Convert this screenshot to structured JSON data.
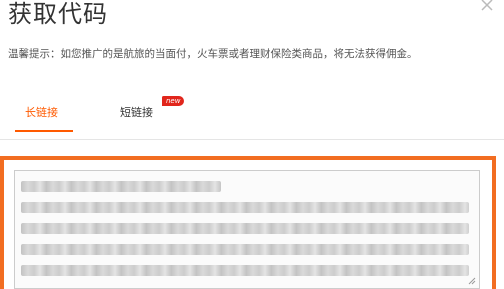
{
  "dialog": {
    "title": "获取代码",
    "tip": "温馨提示：如您推广的是航旅的当面付，火车票或者理财保险类商品，将无法获得佣金。"
  },
  "tabs": {
    "long_label": "长链接",
    "short_label": "短链接",
    "short_badge": "new"
  },
  "colors": {
    "accent": "#ff5a00",
    "frame": "#f26d21",
    "badge": "#e1261c"
  },
  "icons": {
    "close": "close-icon",
    "resize": "resize-handle-icon"
  }
}
